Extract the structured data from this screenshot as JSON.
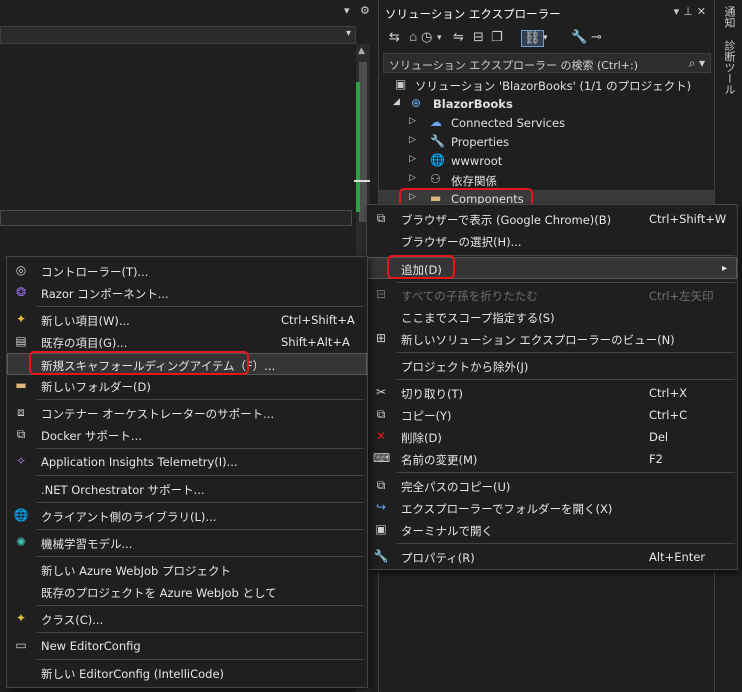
{
  "solution_explorer": {
    "title": "ソリューション エクスプローラー",
    "search_placeholder": "ソリューション エクスプローラー の検索 (Ctrl+:)",
    "tree": [
      {
        "label": "ソリューション 'BlazorBooks' (1/1 のプロジェクト)",
        "icon": "solution-icon"
      },
      {
        "label": "BlazorBooks",
        "icon": "project-icon"
      },
      {
        "label": "Connected Services",
        "icon": "connected-services-icon"
      },
      {
        "label": "Properties",
        "icon": "properties-icon"
      },
      {
        "label": "wwwroot",
        "icon": "globe-icon"
      },
      {
        "label": "依存関係",
        "icon": "dependencies-icon"
      },
      {
        "label": "Components",
        "icon": "folder-icon"
      }
    ]
  },
  "side_tabs": [
    "通知",
    "診断ツール"
  ],
  "context_menu": {
    "items": [
      {
        "label": "ブラウザーで表示 (Google Chrome)(B)",
        "shortcut": "Ctrl+Shift+W",
        "icon": "browser-view-icon"
      },
      {
        "label": "ブラウザーの選択(H)...",
        "shortcut": "",
        "icon": ""
      },
      {
        "label": "追加(D)",
        "shortcut": "",
        "icon": "",
        "submenu_arrow": "▸"
      },
      {
        "label": "すべての子孫を折りたたむ",
        "shortcut": "Ctrl+左矢印",
        "icon": "collapse-all-icon",
        "disabled": true
      },
      {
        "label": "ここまでスコープ指定する(S)",
        "shortcut": "",
        "icon": ""
      },
      {
        "label": "新しいソリューション エクスプローラーのビュー(N)",
        "shortcut": "",
        "icon": "new-view-icon"
      },
      {
        "label": "プロジェクトから除外(J)",
        "shortcut": "",
        "icon": ""
      },
      {
        "label": "切り取り(T)",
        "shortcut": "Ctrl+X",
        "icon": "cut-icon"
      },
      {
        "label": "コピー(Y)",
        "shortcut": "Ctrl+C",
        "icon": "copy-icon"
      },
      {
        "label": "削除(D)",
        "shortcut": "Del",
        "icon": "delete-icon"
      },
      {
        "label": "名前の変更(M)",
        "shortcut": "F2",
        "icon": "rename-icon"
      },
      {
        "label": "完全パスのコピー(U)",
        "shortcut": "",
        "icon": "copy-path-icon"
      },
      {
        "label": "エクスプローラーでフォルダーを開く(X)",
        "shortcut": "",
        "icon": "open-folder-icon"
      },
      {
        "label": "ターミナルで開く",
        "shortcut": "",
        "icon": "terminal-icon"
      },
      {
        "label": "プロパティ(R)",
        "shortcut": "Alt+Enter",
        "icon": "wrench-icon"
      }
    ]
  },
  "add_submenu": {
    "items": [
      {
        "label": "コントローラー(T)...",
        "shortcut": "",
        "icon": "controller-icon"
      },
      {
        "label": "Razor コンポーネント...",
        "shortcut": "",
        "icon": "razor-icon"
      },
      {
        "label": "新しい項目(W)...",
        "shortcut": "Ctrl+Shift+A",
        "icon": "new-item-icon"
      },
      {
        "label": "既存の項目(G)...",
        "shortcut": "Shift+Alt+A",
        "icon": "existing-item-icon"
      },
      {
        "label": "新規スキャフォールディングアイテム（F）...",
        "shortcut": "",
        "icon": ""
      },
      {
        "label": "新しいフォルダー(D)",
        "shortcut": "",
        "icon": "new-folder-icon"
      },
      {
        "label": "コンテナー オーケストレーターのサポート...",
        "shortcut": "",
        "icon": "container-icon"
      },
      {
        "label": "Docker サポート...",
        "shortcut": "",
        "icon": "docker-icon"
      },
      {
        "label": "Application Insights Telemetry(I)...",
        "shortcut": "",
        "icon": "insights-icon"
      },
      {
        "label": ".NET Orchestrator サポート...",
        "shortcut": "",
        "icon": ""
      },
      {
        "label": "クライアント側のライブラリ(L)...",
        "shortcut": "",
        "icon": "library-icon"
      },
      {
        "label": "機械学習モデル...",
        "shortcut": "",
        "icon": "ml-model-icon"
      },
      {
        "label": "新しい Azure WebJob プロジェクト",
        "shortcut": "",
        "icon": ""
      },
      {
        "label": "既存のプロジェクトを Azure WebJob として",
        "shortcut": "",
        "icon": ""
      },
      {
        "label": "クラス(C)...",
        "shortcut": "",
        "icon": "class-icon"
      },
      {
        "label": "New EditorConfig",
        "shortcut": "",
        "icon": "editorconfig-icon"
      },
      {
        "label": "新しい EditorConfig (IntelliCode)",
        "shortcut": "",
        "icon": ""
      }
    ]
  },
  "colors": {
    "highlight_border": "#e5171e",
    "background": "#1f1f1f",
    "menu_border": "#454545"
  }
}
